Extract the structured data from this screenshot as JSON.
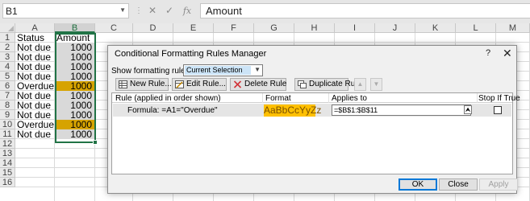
{
  "formula_bar": {
    "name_box": "B1",
    "cancel_icon": "✕",
    "enter_icon": "✓",
    "function_icon": "fx",
    "value": "Amount"
  },
  "sheet": {
    "columns": [
      "A",
      "B",
      "C",
      "D",
      "E",
      "F",
      "G",
      "H",
      "I",
      "J",
      "K",
      "L",
      "M"
    ],
    "selected_column": "B",
    "rows": [
      "1",
      "2",
      "3",
      "4",
      "5",
      "6",
      "7",
      "8",
      "9",
      "10",
      "11",
      "12",
      "13",
      "14",
      "15",
      "16"
    ],
    "data": [
      {
        "a": "Status",
        "b": "Amount"
      },
      {
        "a": "Not due",
        "b": "1000"
      },
      {
        "a": "Not due",
        "b": "1000"
      },
      {
        "a": "Not due",
        "b": "1000"
      },
      {
        "a": "Not due",
        "b": "1000"
      },
      {
        "a": "Overdue",
        "b": "1000",
        "highlight": true
      },
      {
        "a": "Not due",
        "b": "1000"
      },
      {
        "a": "Not due",
        "b": "1000"
      },
      {
        "a": "Not due",
        "b": "1000"
      },
      {
        "a": "Overdue",
        "b": "1000",
        "highlight": true
      },
      {
        "a": "Not due",
        "b": "1000"
      }
    ],
    "highlight_color": "#d6a300",
    "selection_color": "#217346"
  },
  "dialog": {
    "title": "Conditional Formatting Rules Manager",
    "help": "?",
    "close": "✕",
    "show_label": "Show formatting rules for:",
    "show_value": "Current Selection",
    "toolbar": {
      "new_rule": "New Rule...",
      "edit_rule": "Edit Rule...",
      "delete_rule": "Delete Rule",
      "duplicate_rule": "Duplicate Rule"
    },
    "table_headers": {
      "rule": "Rule (applied in order shown)",
      "format": "Format",
      "applies_to": "Applies to",
      "stop_if_true": "Stop If True"
    },
    "rules": [
      {
        "formula": "Formula: =A1=\"Overdue\"",
        "preview": "AaBbCcYyZz",
        "applies_to": "=$B$1:$B$11",
        "stop_if_true": false,
        "format_color": "#ffc000"
      }
    ],
    "buttons": {
      "ok": "OK",
      "close": "Close",
      "apply": "Apply"
    }
  }
}
